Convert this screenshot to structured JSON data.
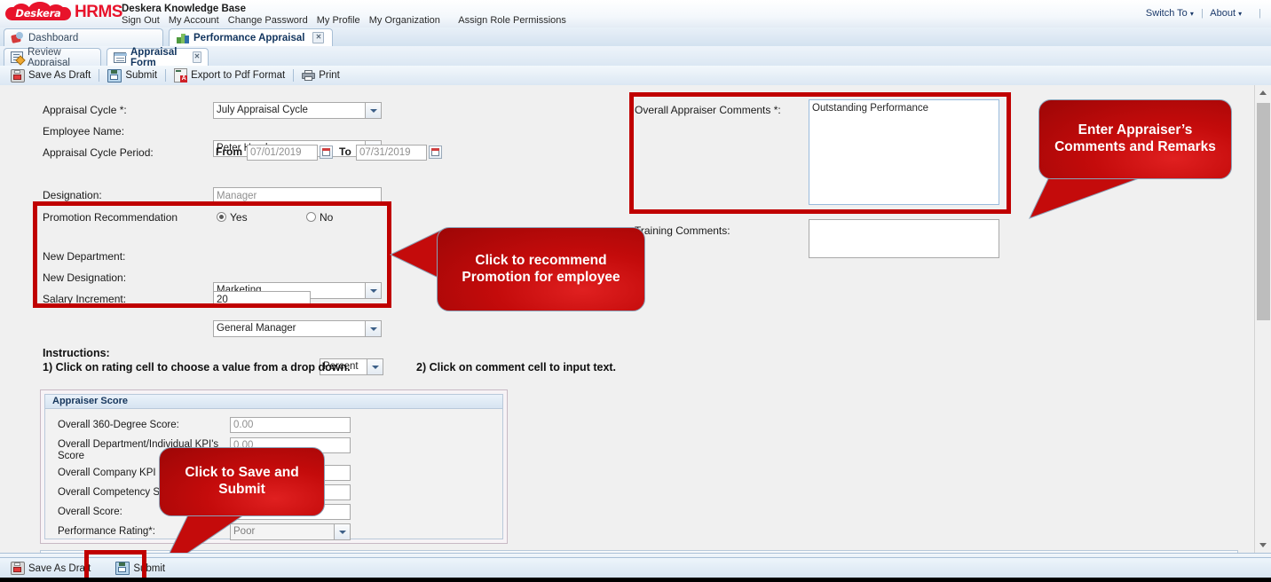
{
  "header": {
    "logo_cloud_text": "Deskera",
    "logo_suffix": "HRMS",
    "app_title": "Deskera Knowledge Base",
    "nav_links": [
      "Sign Out",
      "My Account",
      "Change Password",
      "My Profile",
      "My Organization",
      "Assign Role Permissions"
    ],
    "switch_to": "Switch To",
    "about": "About",
    "caret": "▾"
  },
  "tabs_primary": [
    {
      "label": "Dashboard",
      "icon": "dashboard-icon",
      "active": false,
      "closable": false
    },
    {
      "label": "Performance Appraisal",
      "icon": "performance-appraisal-icon",
      "active": true,
      "closable": true
    }
  ],
  "tabs_secondary": [
    {
      "label": "Review Appraisal",
      "icon": "review-appraisal-icon",
      "active": false,
      "closable": false
    },
    {
      "label": "Appraisal Form",
      "icon": "appraisal-form-icon",
      "active": true,
      "closable": true
    }
  ],
  "toolbar": {
    "save_as_draft": "Save As Draft",
    "submit": "Submit",
    "export_pdf": "Export to Pdf Format",
    "print": "Print"
  },
  "form": {
    "appraisal_cycle_label": "Appraisal Cycle *:",
    "appraisal_cycle_value": "July Appraisal Cycle",
    "employee_name_label": "Employee Name:",
    "employee_name_value": "Peter Hayden",
    "cycle_period_label": "Appraisal Cycle Period:",
    "from_label": "From",
    "from_value": "07/01/2019",
    "to_label": "To",
    "to_value": "07/31/2019",
    "designation_label": "Designation:",
    "designation_value": "Manager",
    "promotion_label": "Promotion Recommendation",
    "promotion_yes": "Yes",
    "promotion_no": "No",
    "promotion_selected": "Yes",
    "new_department_label": "New Department:",
    "new_department_value": "Marketing",
    "new_designation_label": "New Designation:",
    "new_designation_value": "General Manager",
    "salary_increment_label": "Salary Increment:",
    "salary_increment_value": "20",
    "salary_increment_unit": "Percent"
  },
  "comments": {
    "overall_appraiser_label": "Overall Appraiser Comments *:",
    "overall_appraiser_value": "Outstanding Performance",
    "training_label": "Training Comments:",
    "training_value": ""
  },
  "instructions": {
    "heading": "Instructions:",
    "line1": "1) Click on rating cell to choose a value from a drop down.",
    "line2": "2) Click on comment cell to input text."
  },
  "appraiser_score": {
    "panel_title": "Appraiser Score",
    "rows": [
      {
        "label": "Overall 360-Degree Score:",
        "value": "0.00",
        "type": "text"
      },
      {
        "label": "Overall Department/Individual KPI's Score",
        "value": "0.00",
        "type": "text"
      },
      {
        "label": "Overall Company KPI Score:",
        "value": "",
        "type": "text"
      },
      {
        "label": "Overall Competency Score:",
        "value": "",
        "type": "text"
      },
      {
        "label": "Overall Score:",
        "value": "",
        "type": "text"
      },
      {
        "label": "Performance Rating*:",
        "value": "Poor",
        "type": "select"
      }
    ]
  },
  "bottom_toolbar": {
    "save_as_draft": "Save As Draft",
    "submit": "Submit"
  },
  "callouts": [
    {
      "id": "appraiser-comments",
      "text": "Enter Appraiser’s Comments and Remarks"
    },
    {
      "id": "promotion",
      "text": "Click to recommend Promotion for employee"
    },
    {
      "id": "save-submit",
      "text": "Click to Save and Submit"
    }
  ],
  "colors": {
    "brand_red": "#e8132b",
    "annotation_red": "#c00000",
    "chrome_blue": "#d4e2f0",
    "content_bg": "#f0f0f0"
  }
}
